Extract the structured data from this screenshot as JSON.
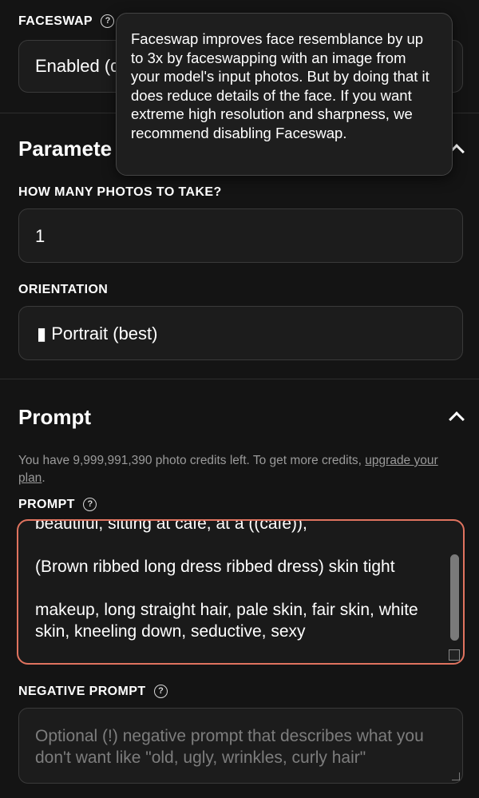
{
  "faceswap": {
    "label": "FACESWAP",
    "help_icon": "?",
    "value": "Enabled (d"
  },
  "tooltip": {
    "text": "Faceswap improves face resemblance by up to 3x by faceswapping with an image from your model's input photos. But by doing that it does reduce details of the face. If you want extreme high resolution and sharpness, we recommend disabling Faceswap."
  },
  "parameters": {
    "heading": "Paramete",
    "photos_label": "HOW MANY PHOTOS TO TAKE?",
    "photos_value": "1",
    "orientation_label": "ORIENTATION",
    "orientation_value": "▮ Portrait (best)"
  },
  "prompt_section": {
    "heading": "Prompt",
    "credits_text": "You have 9,999,991,390 photo credits left. To get more credits, ",
    "upgrade_link": "upgrade your plan",
    "credits_suffix": ".",
    "prompt_label": "PROMPT",
    "prompt_text": "beautiful, sitting at cafe, at a ((cafe)),\n\n(Brown ribbed long dress ribbed dress) skin tight\n\nmakeup, long straight hair, pale skin, fair skin, white skin, kneeling down, seductive, sexy",
    "negative_label": "NEGATIVE PROMPT",
    "negative_placeholder": "Optional (!) negative prompt that describes what you don't want like \"old, ugly, wrinkles, curly hair\""
  },
  "colors": {
    "background": "#141414",
    "accent_border": "#e0735f"
  }
}
